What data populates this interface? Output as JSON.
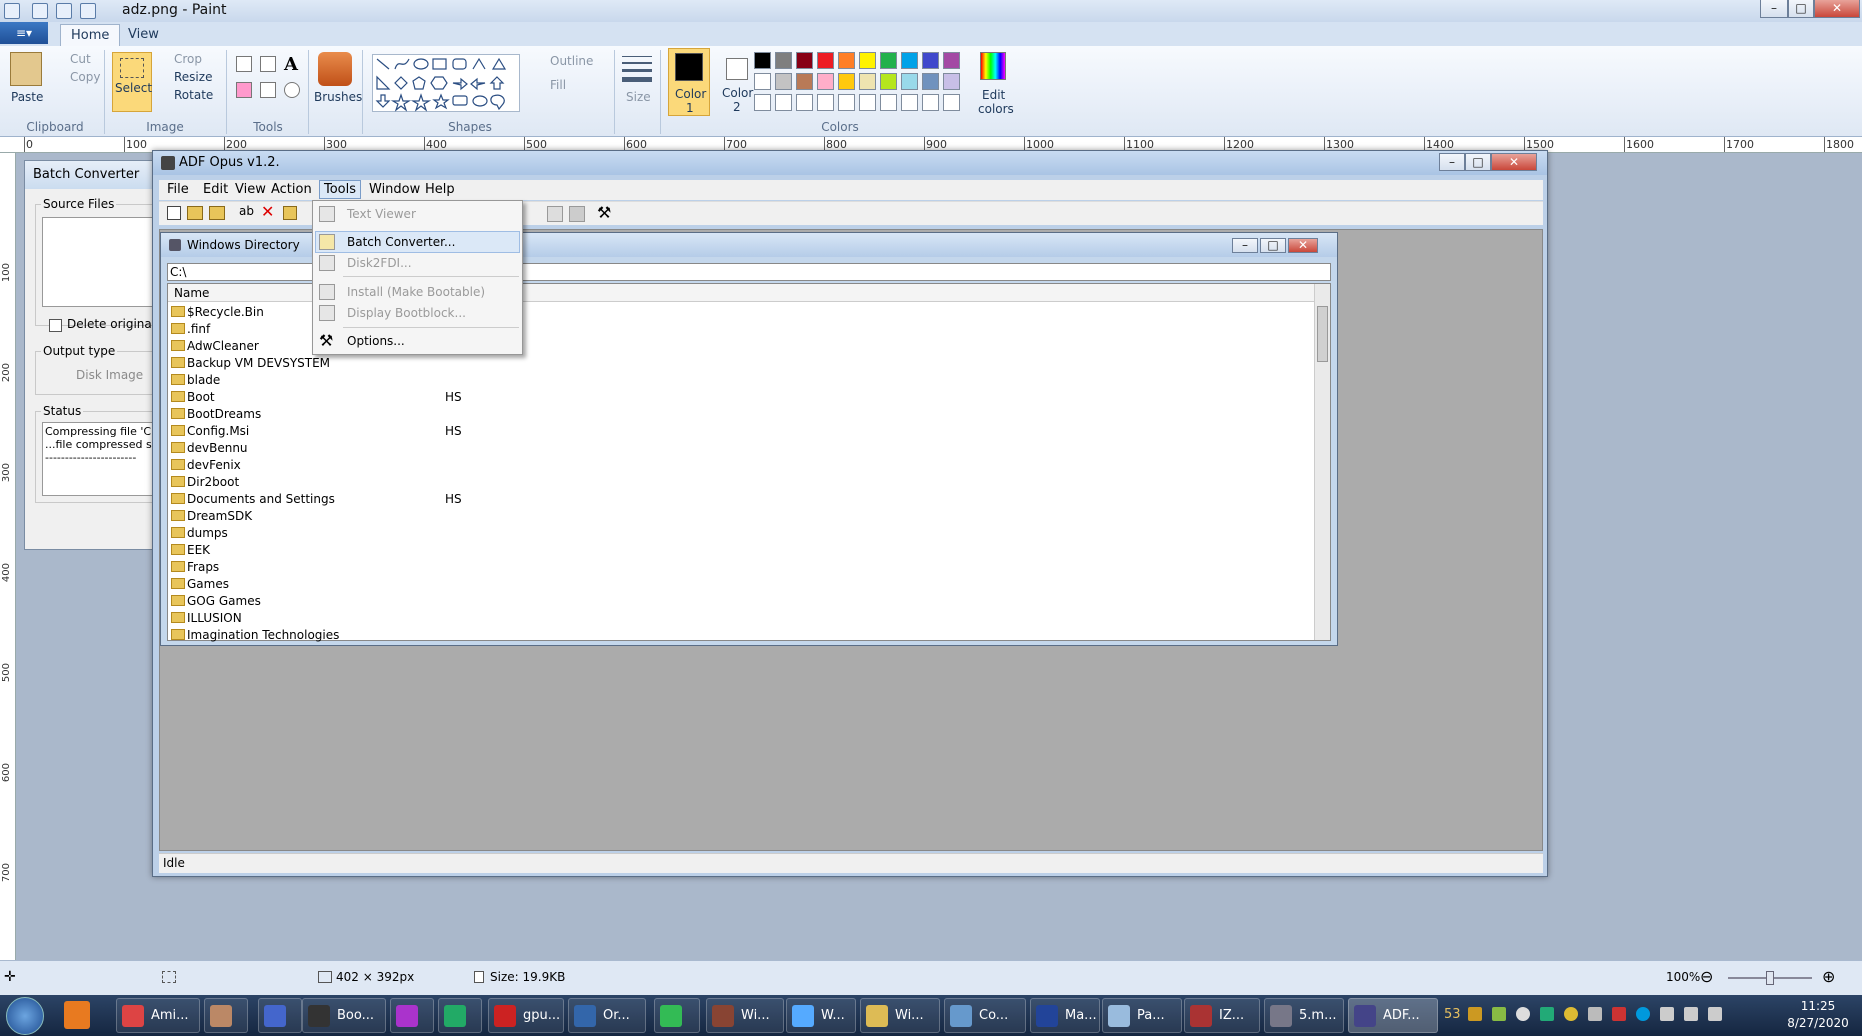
{
  "paint": {
    "title": "adz.png - Paint",
    "window_controls": {
      "minimize": "–",
      "maximize": "□",
      "close": "✕"
    },
    "tabs": [
      {
        "label": "Home"
      },
      {
        "label": "View"
      }
    ],
    "app_menu_label": "≡▾",
    "clipboard": {
      "paste": "Paste",
      "cut": "Cut",
      "copy": "Copy",
      "group": "Clipboard"
    },
    "image": {
      "select": "Select",
      "crop": "Crop",
      "resize": "Resize",
      "rotate": "Rotate",
      "group": "Image"
    },
    "tools": {
      "group": "Tools"
    },
    "brushes": {
      "label": "Brushes"
    },
    "shapes": {
      "outline": "Outline",
      "fill": "Fill",
      "group": "Shapes"
    },
    "size": {
      "label": "Size"
    },
    "colors": {
      "color1": "Color\n1",
      "color1_a": "Color",
      "color1_b": "1",
      "color2_a": "Color",
      "color2_b": "2",
      "edit_a": "Edit",
      "edit_b": "colors",
      "group": "Colors",
      "row1": [
        "#000000",
        "#7f7f7f",
        "#880015",
        "#ed1c24",
        "#ff7f27",
        "#fff200",
        "#22b14c",
        "#00a2e8",
        "#3f48cc",
        "#a349a4"
      ],
      "row2": [
        "#ffffff",
        "#c3c3c3",
        "#b97a57",
        "#ffaec9",
        "#ffc90e",
        "#efe4b0",
        "#b5e61d",
        "#99d9ea",
        "#7092be",
        "#c8bfe7"
      ],
      "row3": [
        "#ffffff",
        "#ffffff",
        "#ffffff",
        "#ffffff",
        "#ffffff",
        "#ffffff",
        "#ffffff",
        "#ffffff",
        "#ffffff",
        "#ffffff"
      ]
    },
    "ruler_h": [
      "0",
      "100",
      "200",
      "300",
      "400",
      "500",
      "600",
      "700",
      "800",
      "900",
      "1000",
      "1100",
      "1200",
      "1300",
      "1400",
      "1500",
      "1600",
      "1700",
      "1800"
    ],
    "ruler_v": [
      "100",
      "200",
      "300",
      "400",
      "500",
      "600",
      "700"
    ],
    "status": {
      "dimensions": "402 × 392px",
      "size": "Size: 19.9KB",
      "zoom": "100%",
      "zoom_minus": "⊖",
      "zoom_plus": "⊕"
    }
  },
  "batch": {
    "title": "Batch Converter",
    "source_files": "Source Files",
    "delete_original": "Delete original file",
    "output_type": "Output type",
    "disk_image": "Disk Image",
    "status": "Status",
    "status_line1": "Compressing file 'C:\\",
    "status_line2": "...file compressed su",
    "status_line3": "-----------------------"
  },
  "adf": {
    "title": "ADF Opus v1.2.",
    "menu": [
      "File",
      "Edit",
      "View",
      "Action",
      "Tools",
      "Window",
      "Help"
    ],
    "status": "Idle",
    "dropdown": [
      {
        "label": "Text Viewer",
        "enabled": false
      },
      {
        "label": "Batch Converter...",
        "enabled": true
      },
      {
        "label": "Disk2FDI...",
        "enabled": false
      },
      {
        "label": "Install (Make Bootable)",
        "enabled": false
      },
      {
        "label": "Display Bootblock...",
        "enabled": false
      },
      {
        "label": "Options...",
        "enabled": true
      }
    ],
    "dir": {
      "title": "Windows Directory",
      "path": "C:\\",
      "column_name": "Name",
      "rows": [
        {
          "name": "$Recycle.Bin",
          "attr": ""
        },
        {
          "name": ".finf",
          "attr": ""
        },
        {
          "name": "AdwCleaner",
          "attr": ""
        },
        {
          "name": "Backup VM DEVSYSTEM",
          "attr": ""
        },
        {
          "name": "blade",
          "attr": ""
        },
        {
          "name": "Boot",
          "attr": "HS"
        },
        {
          "name": "BootDreams",
          "attr": ""
        },
        {
          "name": "Config.Msi",
          "attr": "HS"
        },
        {
          "name": "devBennu",
          "attr": ""
        },
        {
          "name": "devFenix",
          "attr": ""
        },
        {
          "name": "Dir2boot",
          "attr": ""
        },
        {
          "name": "Documents and Settings",
          "attr": "HS"
        },
        {
          "name": "DreamSDK",
          "attr": ""
        },
        {
          "name": "dumps",
          "attr": ""
        },
        {
          "name": "EEK",
          "attr": ""
        },
        {
          "name": "Fraps",
          "attr": ""
        },
        {
          "name": "Games",
          "attr": ""
        },
        {
          "name": "GOG Games",
          "attr": ""
        },
        {
          "name": "ILLUSION",
          "attr": ""
        },
        {
          "name": "Imagination Technologies",
          "attr": ""
        }
      ]
    }
  },
  "taskbar": {
    "items": [
      {
        "label": "Ami...",
        "color": "#d44"
      },
      {
        "label": "",
        "color": "#b86"
      },
      {
        "label": "",
        "color": "#46c"
      },
      {
        "label": "Boo...",
        "color": "#333"
      },
      {
        "label": "",
        "color": "#a3c"
      },
      {
        "label": "",
        "color": "#2a6"
      },
      {
        "label": "gpu...",
        "color": "#c22"
      },
      {
        "label": "Or...",
        "color": "#36a"
      },
      {
        "label": "",
        "color": "#3b5"
      },
      {
        "label": "Wi...",
        "color": "#843"
      },
      {
        "label": "W...",
        "color": "#5af"
      },
      {
        "label": "Wi...",
        "color": "#db5"
      },
      {
        "label": "Co...",
        "color": "#69c"
      },
      {
        "label": "Ma...",
        "color": "#249"
      },
      {
        "label": "Pa...",
        "color": "#9bd"
      },
      {
        "label": "IZ...",
        "color": "#a33"
      },
      {
        "label": "5.m...",
        "color": "#778"
      },
      {
        "label": "ADF...",
        "color": "#448"
      }
    ],
    "tray_count": "53",
    "time": "11:25",
    "date": "8/27/2020"
  }
}
